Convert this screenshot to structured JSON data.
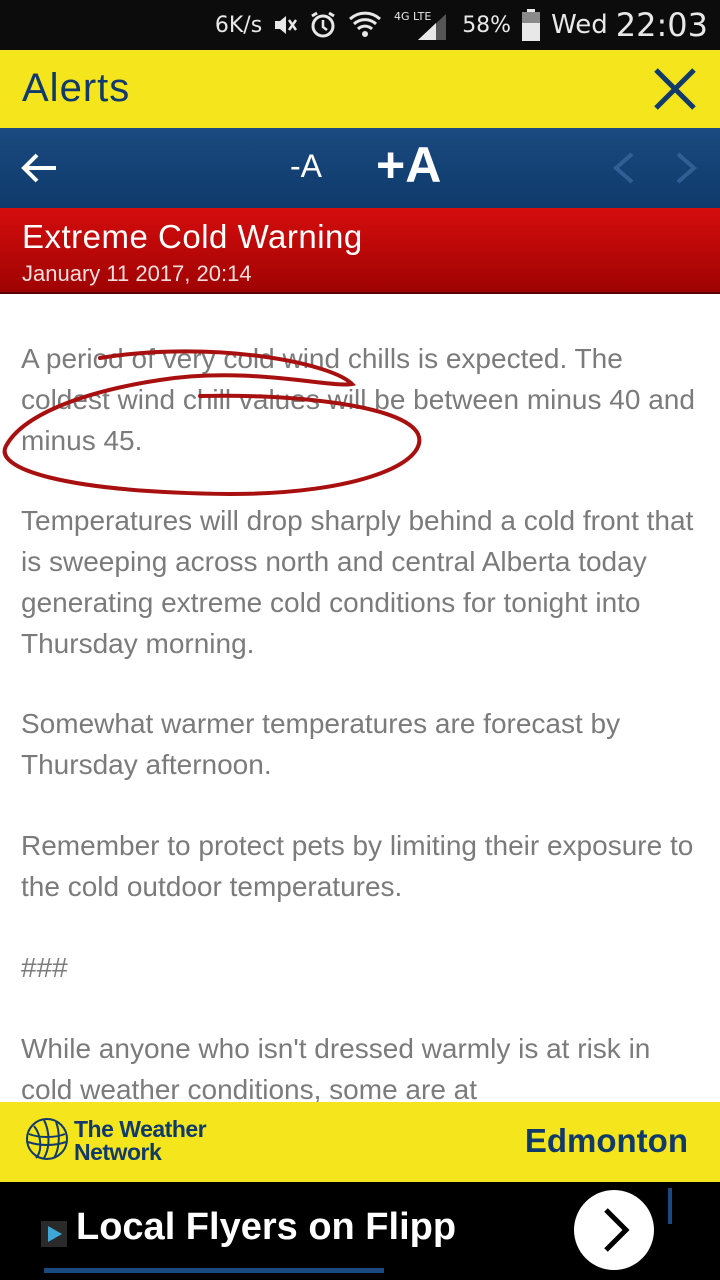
{
  "status_bar": {
    "net_speed": "6K/s",
    "network_type": "4G LTE",
    "battery": "58%",
    "day": "Wed",
    "time": "22:03"
  },
  "header": {
    "title": "Alerts",
    "close_icon": "close-icon"
  },
  "toolbar": {
    "back_icon": "arrow-left-icon",
    "font_smaller_label": "-A",
    "font_larger_label": "+A",
    "prev_icon": "chevron-left-icon",
    "next_icon": "chevron-right-icon"
  },
  "alert": {
    "title": "Extreme Cold Warning",
    "date": "January 11 2017, 20:14",
    "paragraphs": [
      "A period of very cold wind chills is expected. The coldest wind chill values will be between minus 40 and minus 45.",
      "Temperatures will drop sharply behind a cold front that is sweeping across north and central Alberta today generating extreme cold conditions for tonight into Thursday morning.",
      "Somewhat warmer temperatures are forecast by Thursday afternoon.",
      "Remember to protect pets by limiting their exposure to the cold outdoor temperatures.",
      "###",
      "While anyone who isn't dressed warmly is at risk in cold weather conditions, some are at"
    ]
  },
  "footer": {
    "brand": "The Weather\nNetwork",
    "location": "Edmonton"
  },
  "ad": {
    "text": "Local Flyers on Flipp"
  },
  "colors": {
    "title_bar": "#f5e51c",
    "toolbar": "#0f3a6b",
    "alert_header": "#c00808",
    "body_text": "#7b7b7b",
    "annotation": "#b01818"
  }
}
